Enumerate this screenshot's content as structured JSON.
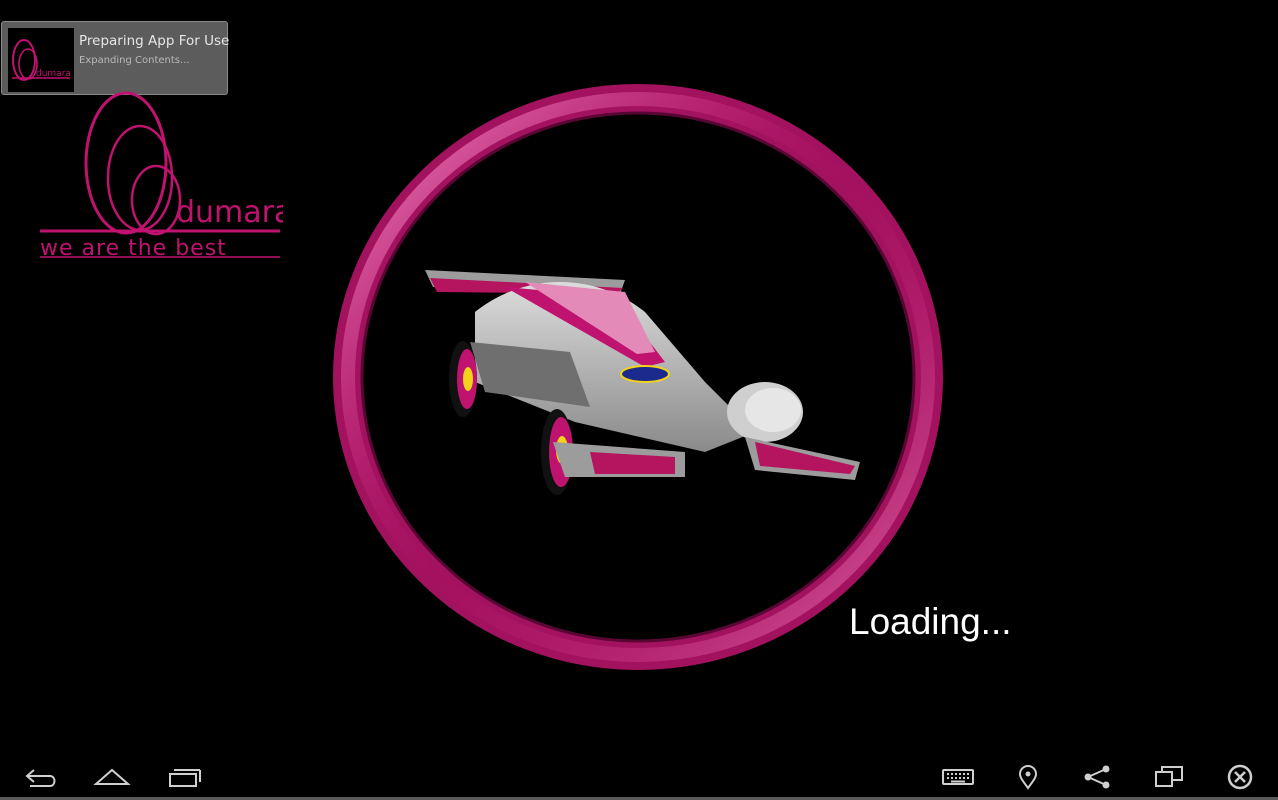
{
  "notification": {
    "title": "Preparing App For Use",
    "subtitle": "Expanding Contents...",
    "icon": "odumara-thumbnail-icon"
  },
  "logo": {
    "brand": "dumara",
    "tagline": "we are the best"
  },
  "splash": {
    "status": "Loading...",
    "image": "race-car-illustration"
  },
  "navbar": {
    "left": [
      "back-icon",
      "home-icon",
      "recent-apps-icon"
    ],
    "right": [
      "keyboard-icon",
      "location-icon",
      "share-icon",
      "window-icon",
      "close-icon"
    ]
  },
  "colors": {
    "accent": "#c0126f",
    "ring": "#b8166f",
    "background": "#000000",
    "toast": "#5c5c5c"
  }
}
